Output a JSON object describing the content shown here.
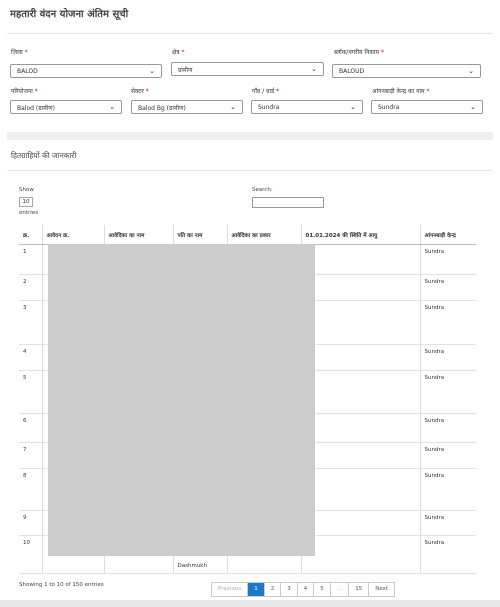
{
  "page_title": "महतारी वंदन योजना अंतिम सूची",
  "filters": {
    "row1": [
      {
        "label": "ज़िला",
        "value": "BALOD"
      },
      {
        "label": "क्षेत्र",
        "value": "ग्रामीण"
      },
      {
        "label": "ब्लॉक/नगरीय निकाय",
        "value": "BALOUD"
      }
    ],
    "row2": [
      {
        "label": "परियोजना",
        "value": "Balod (ग्रामीण)"
      },
      {
        "label": "सेक्टर",
        "value": "Balod Bg (ग्रामीण)"
      },
      {
        "label": "गाँव / वार्ड",
        "value": "Sundra"
      },
      {
        "label": "आंगनबाड़ी केन्द्र का नाम",
        "value": "Sundra"
      }
    ],
    "required_mark": "*"
  },
  "section": {
    "subtitle": "हितग्राहियों की जानकारी",
    "show_label": "Show",
    "show_value": "10",
    "entries_label": "entries",
    "search_label": "Search:"
  },
  "table": {
    "headers": [
      "क्र.",
      "आवेदन क्र.",
      "आवेदिका का नाम",
      "पति का नाम",
      "आवेदिका का प्रकार",
      "01.01.2024 की स्थिति में आयु",
      "आंगनबाड़ी केन्द्र"
    ],
    "rows": [
      {
        "sn": "1",
        "app": "",
        "aw": "Sundra"
      },
      {
        "sn": "2",
        "app": "",
        "aw": "Sundra"
      },
      {
        "sn": "3",
        "app": "",
        "aw": "Sundra"
      },
      {
        "sn": "4",
        "app": "",
        "aw": "Sundra"
      },
      {
        "sn": "5",
        "app": "",
        "aw": "Sundra"
      },
      {
        "sn": "6",
        "app": "",
        "aw": "Sundra"
      },
      {
        "sn": "7",
        "app": "",
        "aw": "Sundra"
      },
      {
        "sn": "8",
        "app": "",
        "aw": "Sundra"
      },
      {
        "sn": "9",
        "app": "",
        "aw": "Sundra"
      },
      {
        "sn": "10",
        "app": "",
        "aw": "Sundra"
      }
    ],
    "visible_partial_text": "Dashmukh"
  },
  "footer": {
    "info": "Showing 1 to 10 of 150 entries",
    "pager": [
      "Previous",
      "1",
      "2",
      "3",
      "4",
      "5",
      "…",
      "15",
      "Next"
    ],
    "active_page": "1"
  },
  "colors": {
    "accent": "#1e78c8",
    "redaction": "#cccccc"
  }
}
